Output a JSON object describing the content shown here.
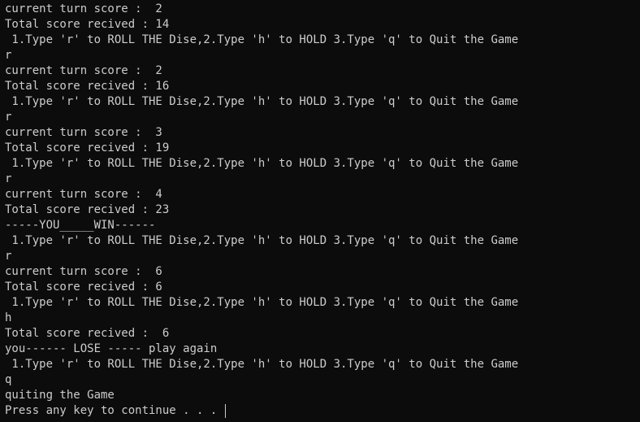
{
  "terminal": {
    "lines": [
      "current turn score :  2",
      "Total score recived : 14",
      " 1.Type 'r' to ROLL THE Dise,2.Type 'h' to HOLD 3.Type 'q' to Quit the Game",
      "r",
      "current turn score :  2",
      "Total score recived : 16",
      " 1.Type 'r' to ROLL THE Dise,2.Type 'h' to HOLD 3.Type 'q' to Quit the Game",
      "r",
      "current turn score :  3",
      "Total score recived : 19",
      " 1.Type 'r' to ROLL THE Dise,2.Type 'h' to HOLD 3.Type 'q' to Quit the Game",
      "r",
      "current turn score :  4",
      "Total score recived : 23",
      "-----YOU_____WIN------",
      " 1.Type 'r' to ROLL THE Dise,2.Type 'h' to HOLD 3.Type 'q' to Quit the Game",
      "r",
      "current turn score :  6",
      "Total score recived : 6",
      " 1.Type 'r' to ROLL THE Dise,2.Type 'h' to HOLD 3.Type 'q' to Quit the Game",
      "h",
      "Total score recived :  6",
      "you------ LOSE ----- play again",
      " 1.Type 'r' to ROLL THE Dise,2.Type 'h' to HOLD 3.Type 'q' to Quit the Game",
      "q",
      "quiting the Game",
      "Press any key to continue . . . "
    ],
    "colors": {
      "background": "#0c0c0c",
      "foreground": "#cccccc"
    }
  }
}
